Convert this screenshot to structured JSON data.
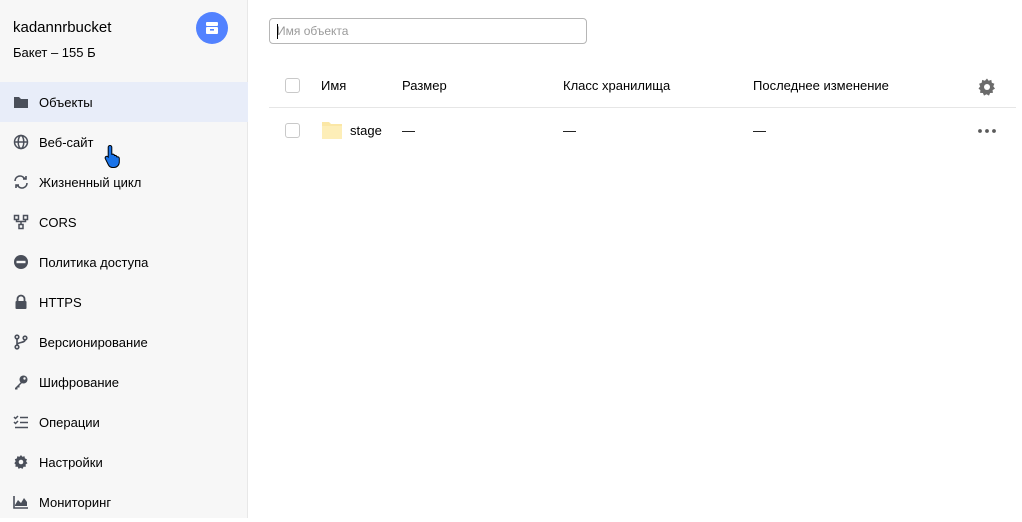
{
  "bucket": {
    "name": "kadannrbucket",
    "subtitle": "Бакет – 155 Б"
  },
  "sidebar": {
    "items": [
      {
        "label": "Объекты",
        "icon": "folder-icon",
        "active": true
      },
      {
        "label": "Веб-сайт",
        "icon": "globe-icon",
        "active": false
      },
      {
        "label": "Жизненный цикл",
        "icon": "cycle-icon",
        "active": false
      },
      {
        "label": "CORS",
        "icon": "cors-icon",
        "active": false
      },
      {
        "label": "Политика доступа",
        "icon": "no-entry-icon",
        "active": false
      },
      {
        "label": "HTTPS",
        "icon": "lock-icon",
        "active": false
      },
      {
        "label": "Версионирование",
        "icon": "branch-icon",
        "active": false
      },
      {
        "label": "Шифрование",
        "icon": "key-icon",
        "active": false
      },
      {
        "label": "Операции",
        "icon": "checklist-icon",
        "active": false
      },
      {
        "label": "Настройки",
        "icon": "gear-icon",
        "active": false
      },
      {
        "label": "Мониторинг",
        "icon": "chart-icon",
        "active": false
      }
    ]
  },
  "search": {
    "placeholder": "Имя объекта",
    "value": ""
  },
  "table": {
    "columns": [
      "Имя",
      "Размер",
      "Класс хранилища",
      "Последнее изменение"
    ],
    "rows": [
      {
        "name": "stage",
        "size": "—",
        "storage_class": "—",
        "modified": "—"
      }
    ]
  },
  "colors": {
    "accent": "#5282ff",
    "sidebar_bg": "#f7f7f7",
    "active_bg": "#e8edf9",
    "icon": "#4a4f5a",
    "folder": "#fbe7a6"
  }
}
